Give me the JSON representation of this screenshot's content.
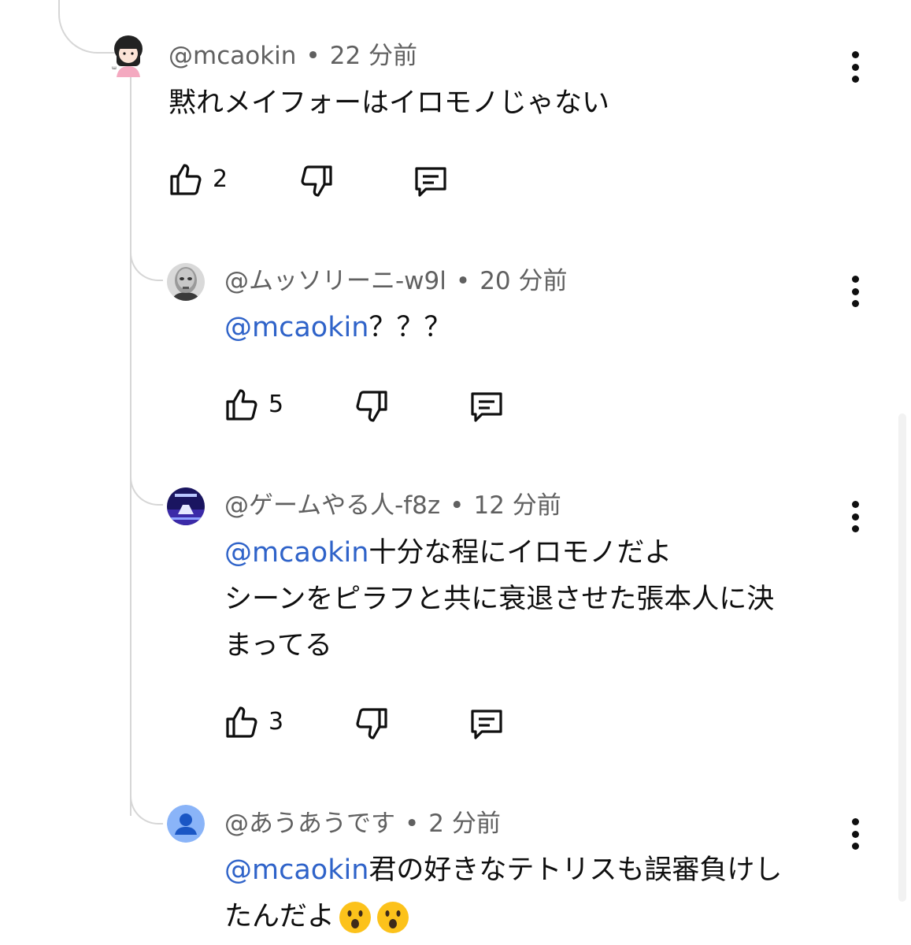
{
  "comments": [
    {
      "author": "@mcaokin",
      "time": "22 分前",
      "mention": "",
      "lines": [
        "黙れメイフォーはイロモノじゃない"
      ],
      "likes": "2",
      "avatar": "girl-avatar"
    },
    {
      "author": "@ムッソリーニ-w9l",
      "time": "20 分前",
      "mention": "@mcaokin",
      "lines": [
        "？？？"
      ],
      "likes": "5",
      "avatar": "grayscale-portrait-avatar"
    },
    {
      "author": "@ゲームやる人-f8z",
      "time": "12 分前",
      "mention": "@mcaokin",
      "lines": [
        "十分な程にイロモノだよ",
        "シーンをピラフと共に衰退させた張本人に決",
        "まってる"
      ],
      "likes": "3",
      "avatar": "game-thumbnail-avatar"
    },
    {
      "author": "@あうあうです",
      "time": "2 分前",
      "mention": "@mcaokin",
      "lines": [
        "君の好きなテトリスも誤審負けし",
        "たんだよ"
      ],
      "likes": "",
      "avatar": "default-person-avatar",
      "emojis": [
        "astonished-face-emoji",
        "astonished-face-emoji"
      ]
    }
  ],
  "separator": "•",
  "colors": {
    "mention": "#2f63c9",
    "meta": "#606060",
    "thread": "#d6d6d6",
    "text": "#0f0f0f"
  },
  "icons": [
    "like-icon",
    "dislike-icon",
    "reply-icon",
    "more-options-icon"
  ]
}
